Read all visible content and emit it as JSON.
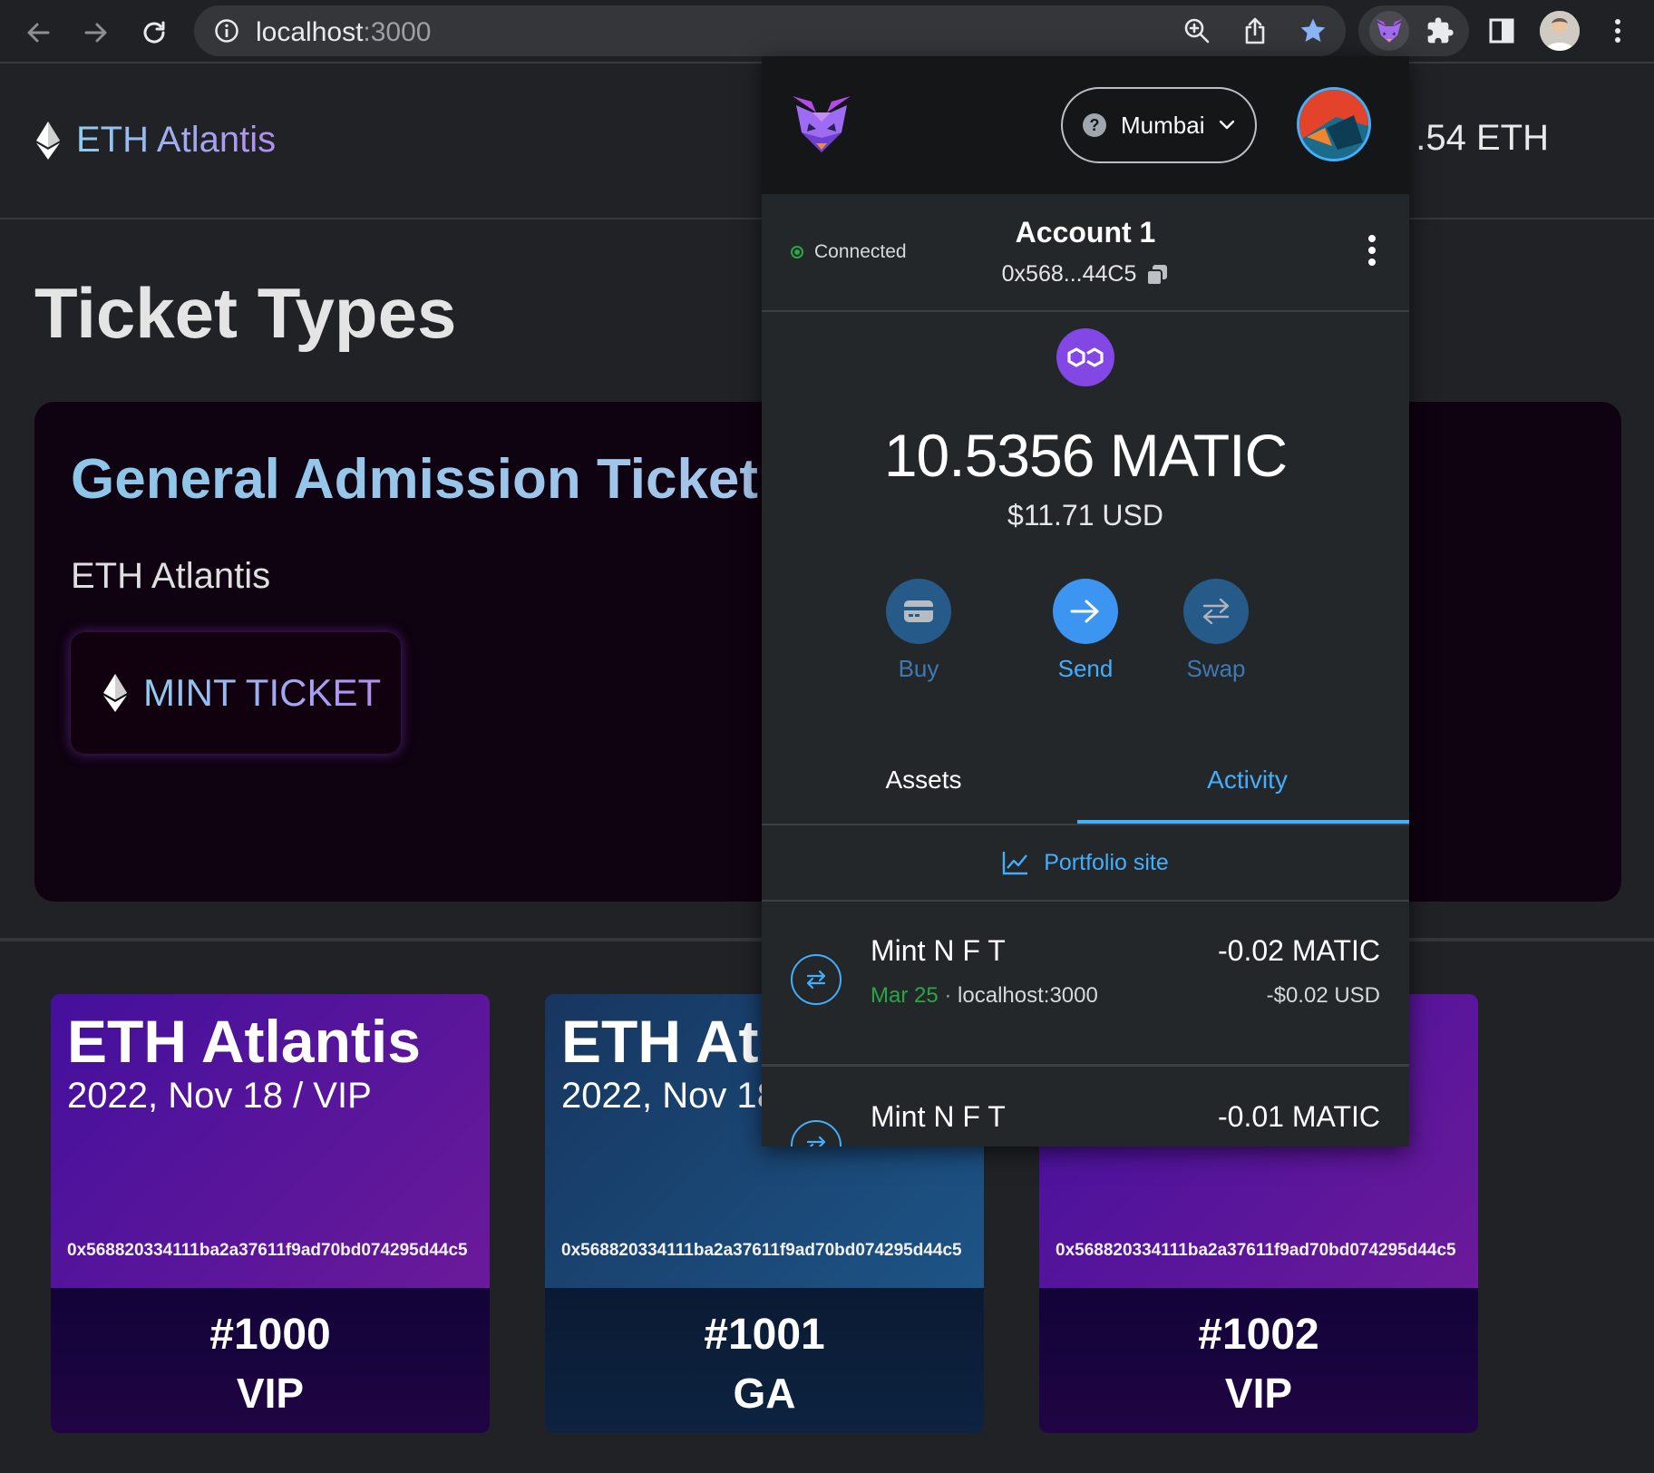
{
  "browser": {
    "url_host": "localhost",
    "url_port": ":3000",
    "icons": [
      "back-arrow-icon",
      "forward-arrow-icon",
      "reload-icon",
      "info-icon",
      "zoom-icon",
      "share-icon",
      "bookmark-star-icon",
      "metamask-fox-icon",
      "puzzle-extensions-icon",
      "side-panel-icon",
      "profile-avatar-icon",
      "more-vertical-icon"
    ]
  },
  "dapp": {
    "brand_name": "ETH Atlantis",
    "balance_text": ".54 ETH",
    "page_title": "Ticket Types",
    "ticket": {
      "title": "General Admission Ticket",
      "subtitle": "ETH Atlantis",
      "mint_label": "MINT TICKET"
    },
    "nfts": [
      {
        "name": "ETH Atlantis",
        "date": "2022, Nov 18 / VIP",
        "address": "0x568820334111ba2a37611f9ad70bd074295d44c5",
        "number": "#1000",
        "type": "VIP"
      },
      {
        "name": "ETH Atl",
        "date": "2022, Nov 18",
        "address": "0x568820334111ba2a37611f9ad70bd074295d44c5",
        "number": "#1001",
        "type": "GA"
      },
      {
        "name": "",
        "date": "",
        "address": "0x568820334111ba2a37611f9ad70bd074295d44c5",
        "number": "#1002",
        "type": "VIP"
      }
    ]
  },
  "metamask": {
    "network": "Mumbai",
    "connection_status": "Connected",
    "account_name": "Account 1",
    "account_address": "0x568...44C5",
    "balance": "10.5356 MATIC",
    "fiat_balance": "$11.71 USD",
    "actions": [
      {
        "label": "Buy",
        "icon": "card-icon"
      },
      {
        "label": "Send",
        "icon": "arrow-right-icon"
      },
      {
        "label": "Swap",
        "icon": "swap-arrows-icon"
      }
    ],
    "tabs": [
      {
        "label": "Assets",
        "active": false
      },
      {
        "label": "Activity",
        "active": true
      }
    ],
    "portfolio_link": "Portfolio site",
    "transactions": [
      {
        "title": "Mint N F T",
        "date": "Mar 25",
        "origin": "localhost:3000",
        "amount": "-0.02 MATIC",
        "fiat": "-$0.02 USD"
      },
      {
        "title": "Mint N F T",
        "date": "",
        "origin": "",
        "amount": "-0.01 MATIC",
        "fiat": ""
      }
    ],
    "colors": {
      "accent": "#43aefc",
      "success": "#28a745",
      "polygon": "#8247e5"
    }
  }
}
